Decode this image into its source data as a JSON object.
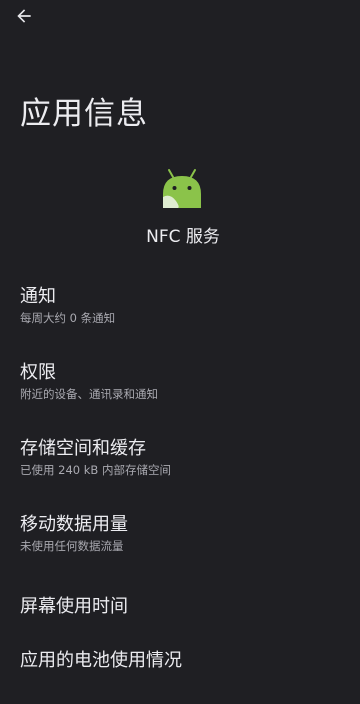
{
  "header": {
    "back_icon": "arrow-left-icon",
    "title": "应用信息"
  },
  "app": {
    "icon": "android-icon",
    "icon_color": "#8bc34a",
    "name": "NFC 服务"
  },
  "colors": {
    "background": "#1f1f23",
    "text_primary": "#ececf0",
    "text_secondary": "#a9a9b0"
  },
  "settings": [
    {
      "title": "通知",
      "subtitle": "每周大约 0 条通知"
    },
    {
      "title": "权限",
      "subtitle": "附近的设备、通讯录和通知"
    },
    {
      "title": "存储空间和缓存",
      "subtitle": "已使用 240 kB 内部存储空间"
    },
    {
      "title": "移动数据用量",
      "subtitle": "未使用任何数据流量"
    },
    {
      "title": "屏幕使用时间",
      "subtitle": ""
    },
    {
      "title": "应用的电池使用情况",
      "subtitle": ""
    }
  ]
}
